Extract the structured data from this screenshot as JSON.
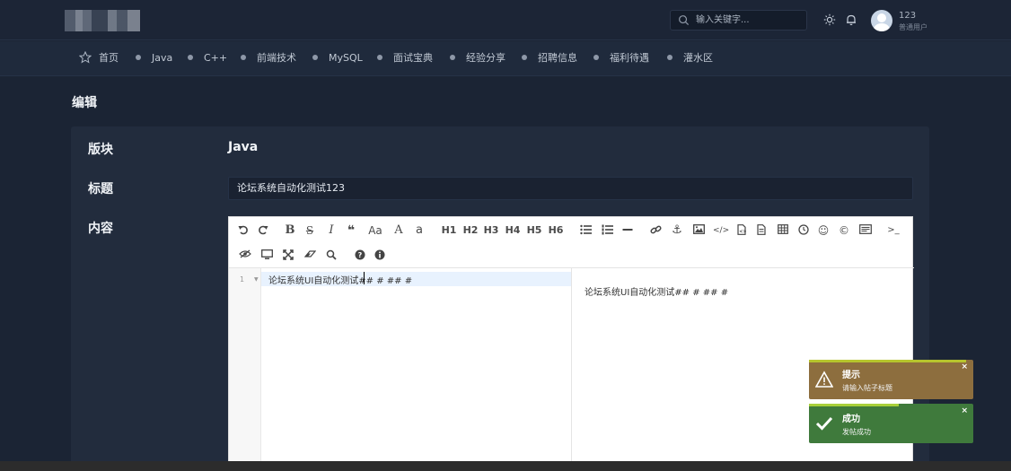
{
  "header": {
    "search_placeholder": "输入关键字...",
    "user": {
      "name": "123",
      "role": "普通用户"
    }
  },
  "nav": {
    "items": [
      {
        "label": "首页",
        "icon": "star-icon"
      },
      {
        "label": "Java"
      },
      {
        "label": "C++"
      },
      {
        "label": "前端技术"
      },
      {
        "label": "MySQL"
      },
      {
        "label": "面试宝典"
      },
      {
        "label": "经验分享"
      },
      {
        "label": "招聘信息"
      },
      {
        "label": "福利待遇"
      },
      {
        "label": "灌水区"
      }
    ]
  },
  "page": {
    "title": "编辑",
    "section_label": "版块",
    "section_value": "Java",
    "title_label": "标题",
    "title_value": "论坛系统自动化测试123",
    "content_label": "内容"
  },
  "editor": {
    "toolbar_row1": [
      "undo-icon",
      "redo-icon",
      "bold-icon",
      "strikethrough-icon",
      "italic-icon",
      "quote-icon",
      "uppercase-icon",
      "lowercase-icon",
      "lowercase-a-icon"
    ],
    "headings": [
      "H1",
      "H2",
      "H3",
      "H4",
      "H5",
      "H6"
    ],
    "line_number": "1",
    "code_text": "论坛系统UI自动化测试## # ## #",
    "preview_text": "论坛系统UI自动化测试## # ## #"
  },
  "toasts": [
    {
      "title": "提示",
      "message": "请输入帖子标题",
      "close": "×",
      "type": "warning"
    },
    {
      "title": "成功",
      "message": "发帖成功",
      "close": "×",
      "type": "success"
    }
  ],
  "colors": {
    "background": "#1b2434",
    "card": "#222c3d",
    "toast_warning": "#8d6e3e",
    "toast_success": "#3f7a3c"
  }
}
